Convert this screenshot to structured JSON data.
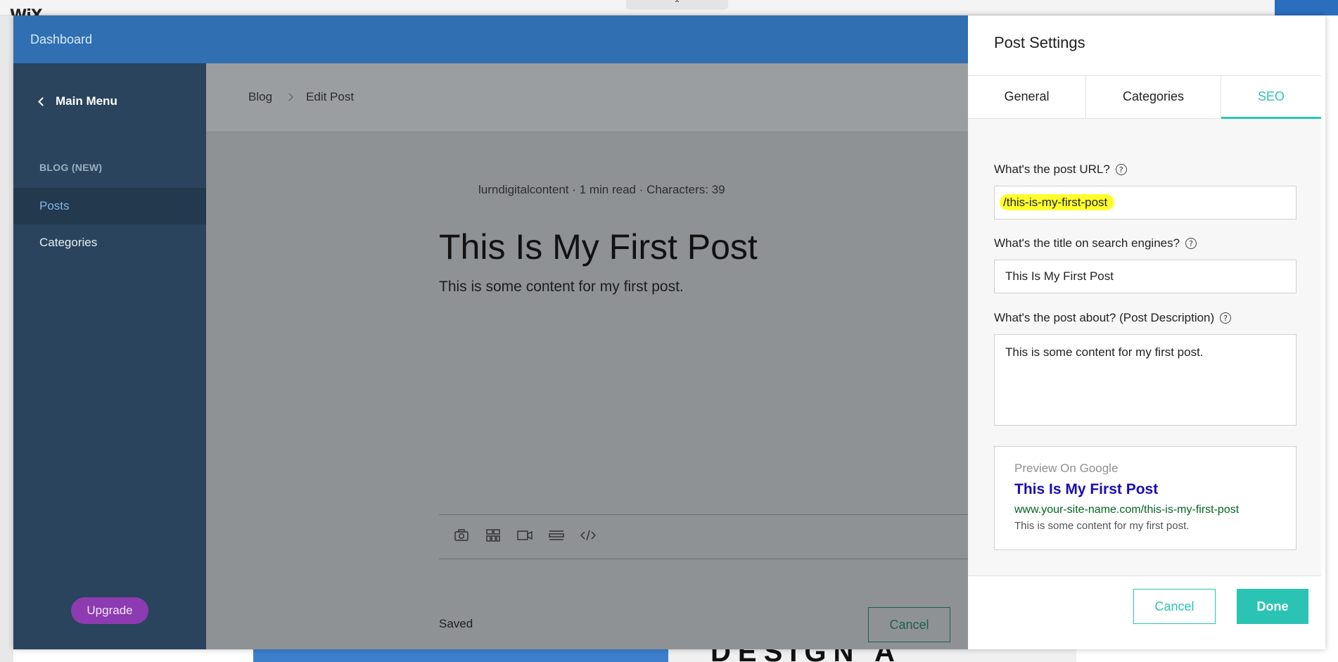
{
  "background": {
    "logo": "WiX",
    "bottom_text": "DESIGN A"
  },
  "header": {
    "title": "Dashboard"
  },
  "sidebar": {
    "main_menu": "Main Menu",
    "section": "BLOG (NEW)",
    "items": [
      {
        "label": "Posts",
        "active": true
      },
      {
        "label": "Categories",
        "active": false
      }
    ],
    "upgrade": "Upgrade"
  },
  "editor": {
    "breadcrumb": [
      "Blog",
      "Edit Post"
    ],
    "author": "lurndigitalcontent",
    "read_time": "1 min read",
    "characters": "Characters: 39",
    "title": "This Is My First Post",
    "body": "This is some content for my first post.",
    "toolbar_icons": [
      "camera-icon",
      "gallery-icon",
      "video-icon",
      "divider-icon",
      "code-icon"
    ],
    "status": "Saved",
    "cancel": "Cancel"
  },
  "settings": {
    "title": "Post Settings",
    "tabs": [
      {
        "label": "General",
        "active": false
      },
      {
        "label": "Categories",
        "active": false
      },
      {
        "label": "SEO",
        "active": true
      }
    ],
    "url_label": "What's the post URL?",
    "url_value": "/this-is-my-first-post",
    "seo_title_label": "What's the title on search engines?",
    "seo_title_value": "This Is My First Post",
    "desc_label": "What's the post about? (Post Description)",
    "desc_value": "This is some content for my first post.",
    "preview": {
      "label": "Preview On Google",
      "title": "This Is My First Post",
      "url": "www.your-site-name.com/this-is-my-first-post",
      "desc": "This is some content for my first post."
    },
    "cancel": "Cancel",
    "done": "Done"
  },
  "colors": {
    "header_blue": "#2f6fb2",
    "sidebar": "#29445c",
    "accent_teal": "#2bc4b4",
    "upgrade_purple": "#8d3bb0",
    "highlight_yellow": "#ffff2e"
  }
}
